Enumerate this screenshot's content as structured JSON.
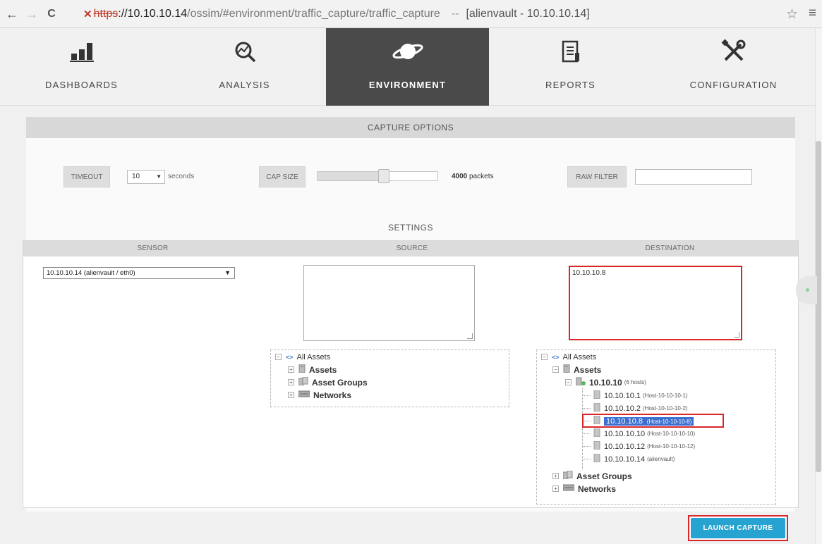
{
  "browser": {
    "back_icon": "←",
    "forward_icon": "→",
    "reload_icon": "C",
    "url_scheme": "https",
    "url_host": "://10.10.10.14",
    "url_path": "/ossim/#environment/traffic_capture/traffic_capture",
    "url_sep": "--",
    "page_title": "[alienvault - 10.10.10.14]",
    "star_icon": "☆",
    "menu_icon": "≡"
  },
  "nav": {
    "items": [
      {
        "label": "DASHBOARDS",
        "icon": "bar-chart-icon"
      },
      {
        "label": "ANALYSIS",
        "icon": "analysis-icon"
      },
      {
        "label": "ENVIRONMENT",
        "icon": "planet-icon"
      },
      {
        "label": "REPORTS",
        "icon": "report-icon"
      },
      {
        "label": "CONFIGURATION",
        "icon": "tools-icon"
      }
    ],
    "active": "ENVIRONMENT"
  },
  "capture_options": {
    "header": "CAPTURE OPTIONS",
    "timeout_label": "TIMEOUT",
    "timeout_value": "10",
    "timeout_unit": "seconds",
    "cap_size_label": "CAP SIZE",
    "cap_size_value": "4000",
    "cap_size_unit": "packets",
    "cap_size_slider_fraction": 0.55,
    "raw_filter_label": "RAW FILTER",
    "raw_filter_value": ""
  },
  "settings": {
    "title": "SETTINGS",
    "sensor_header": "SENSOR",
    "source_header": "SOURCE",
    "destination_header": "DESTINATION",
    "sensor_value": "10.10.10.14 (alienvault / eth0)",
    "source_value": "",
    "destination_value": "10.10.10.8",
    "source_tree": {
      "root": "All Assets",
      "items": [
        "Assets",
        "Asset Groups",
        "Networks"
      ]
    },
    "destination_tree": {
      "root": "All Assets",
      "assets": "Assets",
      "network": "10.10.10",
      "network_note": "(6 hosts)",
      "hosts": [
        {
          "ip": "10.10.10.1",
          "name": "(Host-10-10-10-1)"
        },
        {
          "ip": "10.10.10.2",
          "name": "(Host-10-10-10-2)"
        },
        {
          "ip": "10.10.10.8",
          "name": "(Host-10-10-10-8)"
        },
        {
          "ip": "10.10.10.10",
          "name": "(Host-10-10-10-10)"
        },
        {
          "ip": "10.10.10.12",
          "name": "(Host-10-10-10-12)"
        },
        {
          "ip": "10.10.10.14",
          "name": "(alienvault)"
        }
      ],
      "asset_groups": "Asset Groups",
      "networks": "Networks"
    }
  },
  "launch_label": "LAUNCH CAPTURE",
  "colors": {
    "active_tab": "#4a4a4a",
    "launch_button": "#26a3d0",
    "highlight": "#d9262b",
    "selection": "#3c6fcf"
  }
}
